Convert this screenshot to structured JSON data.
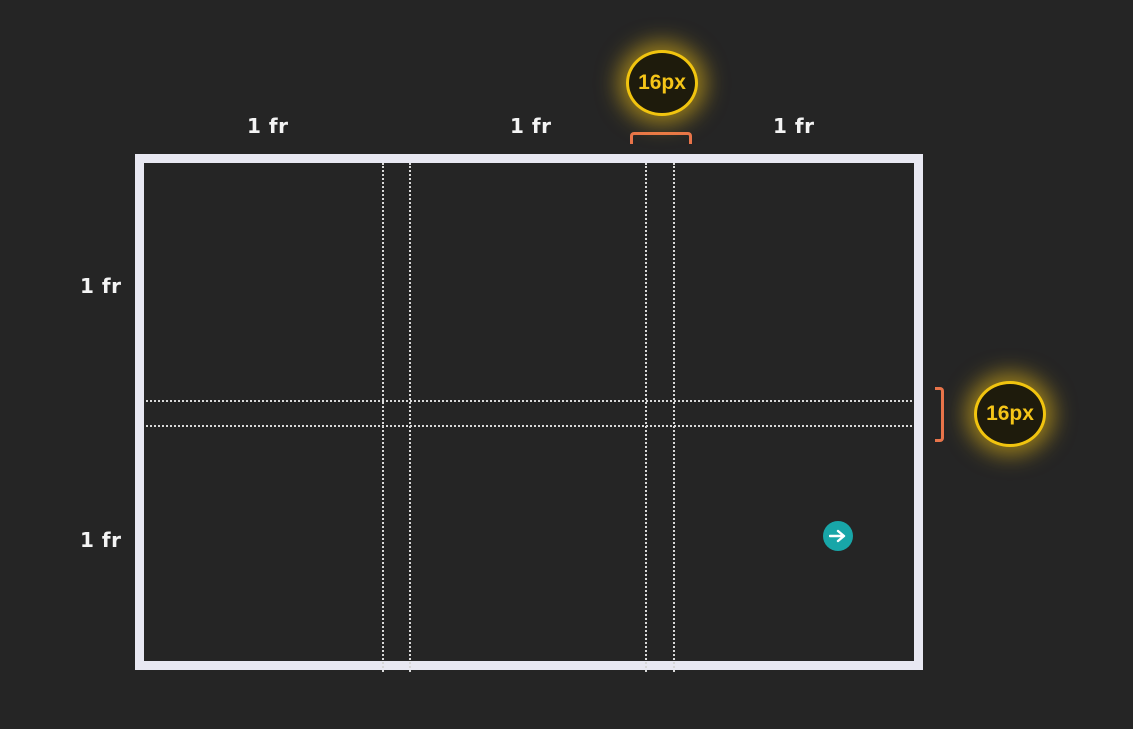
{
  "column_labels": [
    "1 fr",
    "1 fr",
    "1 fr"
  ],
  "row_labels": [
    "1 fr",
    "1 fr"
  ],
  "column_gap_badge": "16px",
  "row_gap_badge": "16px",
  "colors": {
    "background": "#252525",
    "grid_border": "#e8e8f2",
    "gap_lines": "#d8d8d8",
    "badge_glow": "#f1c40f",
    "bracket": "#e8744a",
    "cursor": "#18a6a8"
  },
  "icons": {
    "cursor": "arrow-right-icon"
  }
}
